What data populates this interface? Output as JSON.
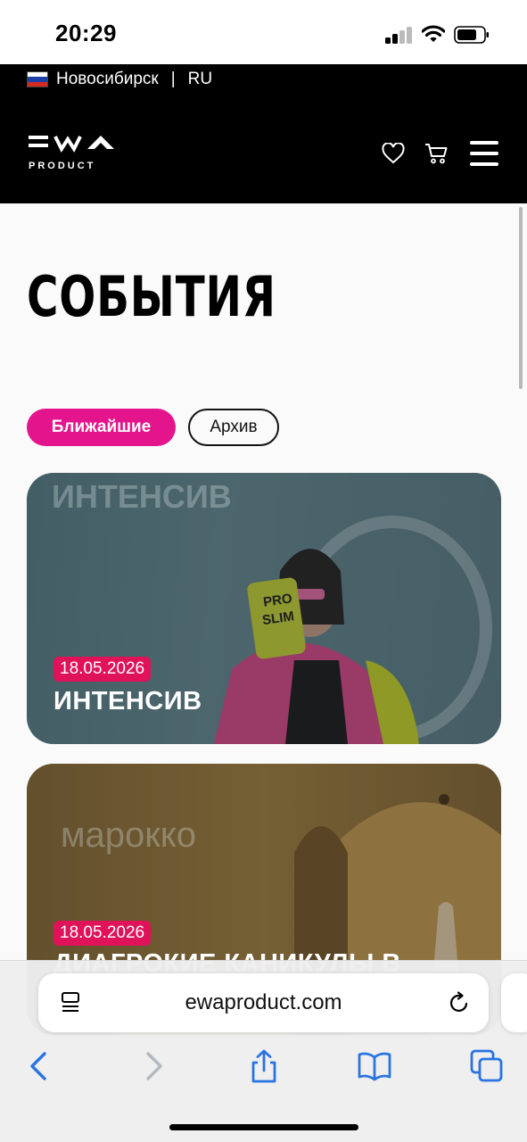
{
  "status_bar": {
    "time": "20:29"
  },
  "header": {
    "city": "Новосибирск",
    "separator": "|",
    "language": "RU",
    "logo_text": "PRODUCT",
    "flag_colors": [
      "#ffffff",
      "#1c3fa8",
      "#d52b1e"
    ]
  },
  "page": {
    "title": "СОБЫТИЯ",
    "tabs": [
      {
        "label": "Ближайшие",
        "active": true
      },
      {
        "label": "Архив",
        "active": false
      }
    ]
  },
  "events": [
    {
      "date": "18.05.2026",
      "title": "ИНТЕНСИВ",
      "image_text": "ИНТЕНСИВ"
    },
    {
      "date": "18.05.2026",
      "title": "ДИАГРОКИЕ КАНИКУЛЫ В",
      "image_text": "марокко"
    }
  ],
  "browser": {
    "url": "ewaproduct.com"
  },
  "colors": {
    "accent": "#e4148c",
    "date_badge": "#e0125a",
    "header_bg": "#000000"
  }
}
